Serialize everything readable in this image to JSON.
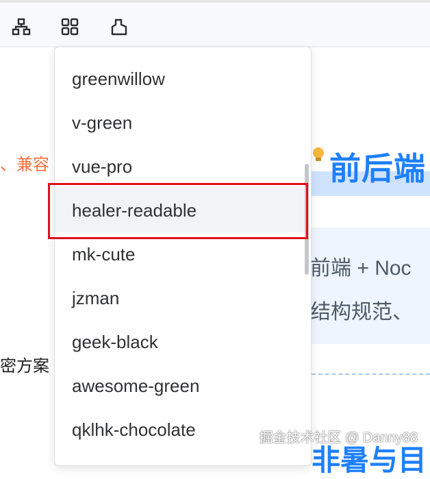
{
  "toolbar": {
    "icons": [
      "sitemap-icon",
      "grid-icon",
      "theme-icon"
    ]
  },
  "background": {
    "left_orange_text": "、兼容",
    "left_black_text": "密方案",
    "heading": "前后端",
    "quote_lines": [
      "前端 + Noc",
      "结构规范、"
    ],
    "bottom_heading": "非暑与目",
    "watermark": "掘金技术社区 @ Danny88"
  },
  "dropdown": {
    "items": [
      {
        "label": "greenwillow"
      },
      {
        "label": "v-green"
      },
      {
        "label": "vue-pro"
      },
      {
        "label": "healer-readable"
      },
      {
        "label": "mk-cute"
      },
      {
        "label": "jzman"
      },
      {
        "label": "geek-black"
      },
      {
        "label": "awesome-green"
      },
      {
        "label": "qklhk-chocolate"
      }
    ],
    "hovered_index": 3
  },
  "colors": {
    "accent_blue": "#1e80ff",
    "orange": "#f2703a",
    "highlight_red": "#e0101b"
  }
}
